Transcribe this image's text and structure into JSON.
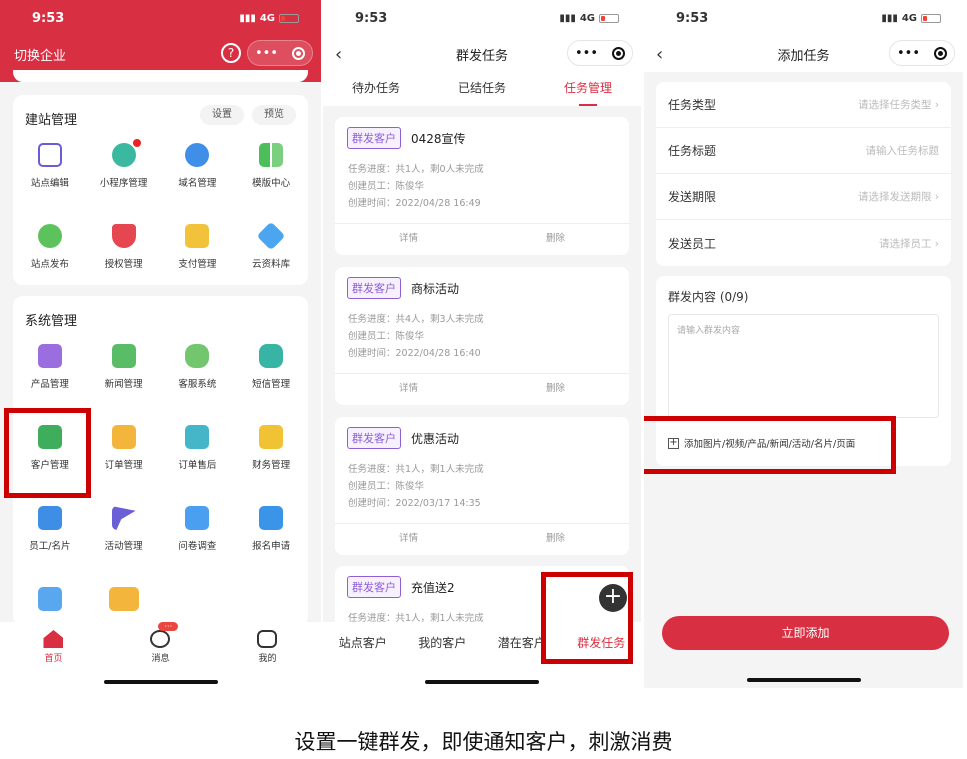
{
  "status": {
    "time": "9:53",
    "network": "4G"
  },
  "p1": {
    "nav_title": "切换企业",
    "site": {
      "title": "建站管理",
      "btn_settings": "设置",
      "btn_preview": "预览",
      "items": [
        {
          "label": "站点编辑",
          "icon": "edit-icon"
        },
        {
          "label": "小程序管理",
          "icon": "miniprogram-icon"
        },
        {
          "label": "域名管理",
          "icon": "globe-icon"
        },
        {
          "label": "模版中心",
          "icon": "template-icon"
        },
        {
          "label": "站点发布",
          "icon": "publish-icon"
        },
        {
          "label": "授权管理",
          "icon": "authorize-icon"
        },
        {
          "label": "支付管理",
          "icon": "payment-icon"
        },
        {
          "label": "云资料库",
          "icon": "cloud-library-icon"
        }
      ]
    },
    "system": {
      "title": "系统管理",
      "items": [
        {
          "label": "产品管理",
          "icon": "product-icon"
        },
        {
          "label": "新闻管理",
          "icon": "news-icon"
        },
        {
          "label": "客服系统",
          "icon": "customer-service-icon"
        },
        {
          "label": "短信管理",
          "icon": "sms-icon"
        },
        {
          "label": "客户管理",
          "icon": "customer-icon"
        },
        {
          "label": "订单管理",
          "icon": "order-icon"
        },
        {
          "label": "订单售后",
          "icon": "after-sale-icon"
        },
        {
          "label": "财务管理",
          "icon": "finance-icon"
        },
        {
          "label": "员工/名片",
          "icon": "staff-icon"
        },
        {
          "label": "活动管理",
          "icon": "flag-icon"
        },
        {
          "label": "问卷调查",
          "icon": "survey-icon"
        },
        {
          "label": "报名申请",
          "icon": "signup-icon"
        }
      ]
    },
    "tabbar": [
      {
        "label": "首页"
      },
      {
        "label": "消息",
        "badge": "···"
      },
      {
        "label": "我的"
      }
    ]
  },
  "p2": {
    "nav_title": "群发任务",
    "tabs": [
      "待办任务",
      "已结任务",
      "任务管理"
    ],
    "tasks": [
      {
        "badge": "群发客户",
        "name": "0428宣传",
        "progress": "任务进度：共1人，剩0人未完成",
        "creator": "创建员工：陈俊华",
        "created": "创建时间：2022/04/28 16:49",
        "detail": "详情",
        "delete": "删除"
      },
      {
        "badge": "群发客户",
        "name": "商标活动",
        "progress": "任务进度：共4人，剩3人未完成",
        "creator": "创建员工：陈俊华",
        "created": "创建时间：2022/04/28 16:40",
        "detail": "详情",
        "delete": "删除"
      },
      {
        "badge": "群发客户",
        "name": "优惠活动",
        "progress": "任务进度：共1人，剩1人未完成",
        "creator": "创建员工：陈俊华",
        "created": "创建时间：2022/03/17 14:35",
        "detail": "详情",
        "delete": "删除"
      },
      {
        "badge": "群发客户",
        "name": "充值送2",
        "progress": "任务进度：共1人，剩1人未完成"
      }
    ],
    "bottom_tabs": [
      "站点客户",
      "我的客户",
      "潜在客户",
      "群发任务"
    ]
  },
  "p3": {
    "nav_title": "添加任务",
    "fields": [
      {
        "label": "任务类型",
        "placeholder": "请选择任务类型",
        "arrow": true
      },
      {
        "label": "任务标题",
        "placeholder": "请输入任务标题",
        "arrow": false
      },
      {
        "label": "发送期限",
        "placeholder": "请选择发送期限",
        "arrow": true
      },
      {
        "label": "发送员工",
        "placeholder": "请选择员工",
        "arrow": true
      }
    ],
    "content_label": "群发内容 (0/9)",
    "content_placeholder": "请输入群发内容",
    "add_media": "添加图片/视频/产品/新闻/活动/名片/页面",
    "submit": "立即添加"
  },
  "caption": "设置一键群发，即使通知客户，刺激消费",
  "colors": {
    "brand": "#d83042",
    "badge": "#8f5fd6",
    "highlight": "#cc0000"
  }
}
